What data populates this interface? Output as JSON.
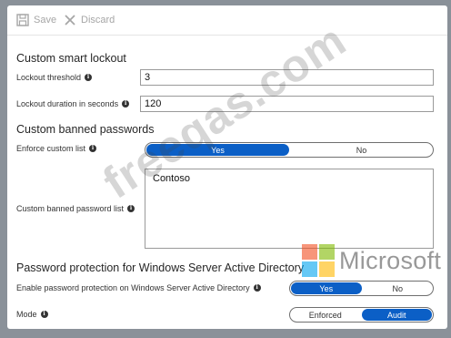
{
  "toolbar": {
    "save_label": "Save",
    "discard_label": "Discard",
    "save_icon": "save-icon",
    "discard_icon": "close-icon"
  },
  "smart_lockout": {
    "title": "Custom smart lockout",
    "threshold_label": "Lockout threshold",
    "threshold_value": "3",
    "duration_label": "Lockout duration in seconds",
    "duration_value": "120"
  },
  "banned_passwords": {
    "title": "Custom banned passwords",
    "enforce_label": "Enforce custom list",
    "enforce_options": [
      "Yes",
      "No"
    ],
    "enforce_selected": "Yes",
    "list_label": "Custom banned password list",
    "list_value": "Contoso"
  },
  "ad_protection": {
    "title": "Password protection for Windows Server Active Directory",
    "enable_label": "Enable password protection on Windows Server Active Directory",
    "enable_options": [
      "Yes",
      "No"
    ],
    "enable_selected": "Yes",
    "mode_label": "Mode",
    "mode_options": [
      "Enforced",
      "Audit"
    ],
    "mode_selected": "Audit"
  },
  "overlay": {
    "watermark_text": "freeqas.com",
    "brand_text": "Microsoft",
    "brand_colors": [
      "#f25022",
      "#7fba00",
      "#00a4ef",
      "#ffb900"
    ]
  },
  "colors": {
    "accent": "#0b5fc6",
    "background": "#8a9199"
  }
}
